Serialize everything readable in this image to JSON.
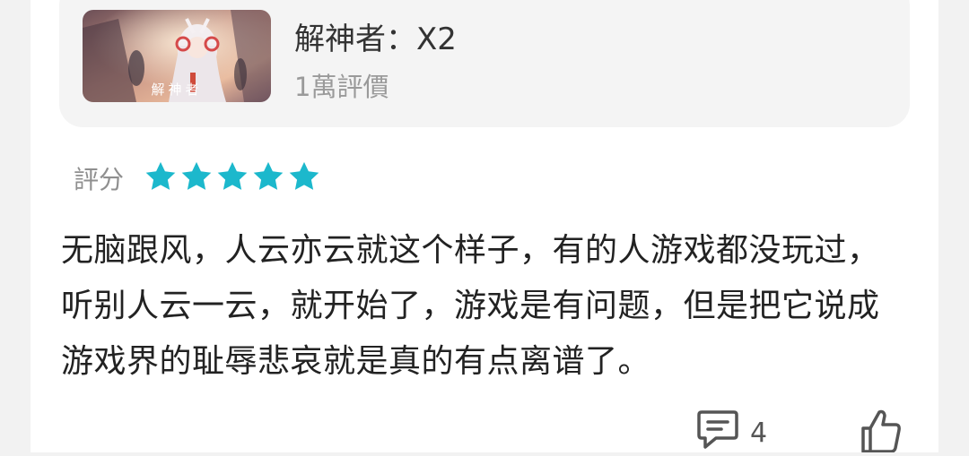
{
  "game": {
    "title": "解神者：X2",
    "reviews": "1萬評價",
    "thumbnail_logo": "解神者"
  },
  "rating": {
    "label": "評分",
    "stars": 5,
    "star_color": "#1cb8cc"
  },
  "review": {
    "text": "无脑跟风，人云亦云就这个样子，有的人游戏都没玩过，听别人云一云，就开始了，游戏是有问题，但是把它说成游戏界的耻辱悲哀就是真的有点离谱了。"
  },
  "actions": {
    "comment_count": "4",
    "comment_icon": "comment-icon",
    "like_icon": "thumbs-up-icon"
  }
}
